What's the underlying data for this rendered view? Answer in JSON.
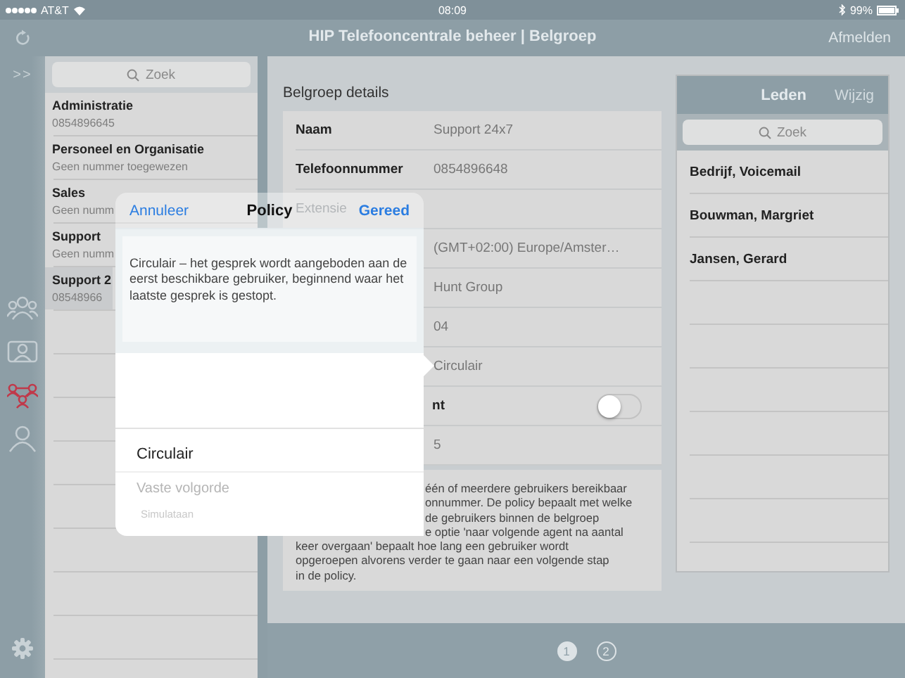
{
  "status_bar": {
    "carrier": "AT&T",
    "time": "08:09",
    "battery": "99%"
  },
  "nav_bar": {
    "title": "HIP Telefooncentrale beheer | Belgroep",
    "logout": "Afmelden"
  },
  "rail": {
    "expand": ">>",
    "items": [
      {
        "kind": "group",
        "selected": false
      },
      {
        "kind": "card",
        "selected": false
      },
      {
        "kind": "network",
        "selected": true
      },
      {
        "kind": "person",
        "selected": false
      }
    ]
  },
  "sidebar": {
    "search": {
      "placeholder": "Zoek"
    },
    "items": [
      {
        "title": "Administratie",
        "subtitle": "0854896645",
        "selected": false
      },
      {
        "title": "Personeel en Organisatie",
        "subtitle": "Geen nummer toegewezen",
        "selected": false
      },
      {
        "title": "Sales",
        "subtitle": "Geen numm",
        "selected": false
      },
      {
        "title": "Support",
        "subtitle": "Geen numm",
        "selected": false
      },
      {
        "title": "Support 2",
        "subtitle": "08548966",
        "selected": true
      }
    ]
  },
  "details": {
    "title": "Belgroep details",
    "rows": [
      {
        "kind": "text",
        "label": "Naam",
        "value": "Support 24x7"
      },
      {
        "kind": "text",
        "label": "Telefoonnummer",
        "value": "0854896648"
      },
      {
        "kind": "faint",
        "label": "Extensie"
      },
      {
        "kind": "text",
        "value": "(GMT+02:00) Europe/Amster…"
      },
      {
        "kind": "text",
        "value": "Hunt Group"
      },
      {
        "kind": "text",
        "value": "04"
      },
      {
        "kind": "text",
        "value": "Circulair"
      },
      {
        "kind": "toggle",
        "label": "nt",
        "on": false
      },
      {
        "kind": "text",
        "value": "5"
      }
    ],
    "description_lines": [
      {
        "text": "één of meerdere gebruikers bereikbaar",
        "covered": true
      },
      {
        "text": "onnummer. De policy bepaalt met welke",
        "covered": true
      },
      {
        "text": "de gebruikers binnen de belgroep",
        "covered": true
      },
      {
        "text": "e optie 'naar volgende agent na aantal",
        "covered": true
      },
      {
        "text": "keer overgaan' bepaalt hoe lang een gebruiker wordt",
        "covered": false
      },
      {
        "text": "opgeroepen alvorens verder te gaan naar een volgende stap",
        "covered": false
      },
      {
        "text": "in de policy.",
        "covered": false
      }
    ]
  },
  "members": {
    "title": "Leden",
    "edit": "Wijzig",
    "search": {
      "placeholder": "Zoek"
    },
    "items": [
      "Bedrijf, Voicemail",
      "Bouwman, Margriet",
      "Jansen, Gerard"
    ]
  },
  "pager": [
    {
      "label": "1",
      "selected": true
    },
    {
      "label": "2",
      "selected": false
    }
  ],
  "popover": {
    "cancel": "Annuleer",
    "title": "Policy",
    "done": "Gereed",
    "description": "Circulair – het gesprek wordt aangeboden aan de eerst beschikbare gebruiker, beginnend waar het laatste gesprek is gestopt.",
    "options": [
      {
        "label": "Circulair",
        "selected": true
      },
      {
        "label": "Vaste volgorde",
        "selected": false
      },
      {
        "label": "Simulataan",
        "selected": false
      }
    ]
  }
}
